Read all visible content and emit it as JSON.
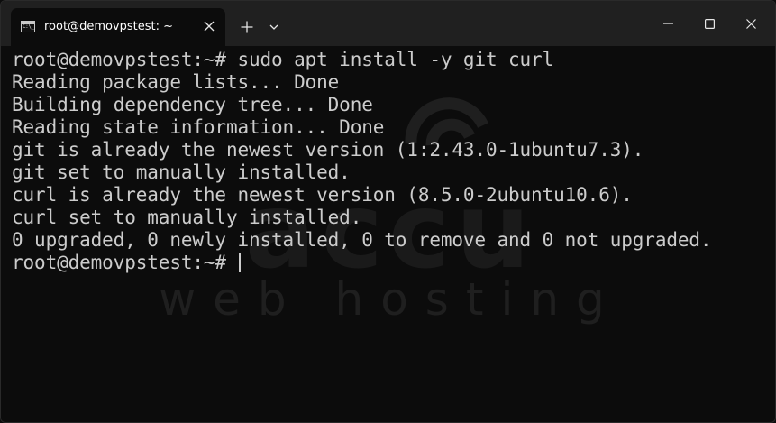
{
  "window": {
    "tab_title": "root@demovpstest: ~",
    "tab_icon": "terminal-icon",
    "icons": {
      "tab_close": "close-icon",
      "new_tab": "plus-icon",
      "dropdown": "chevron-down-icon",
      "minimize": "minimize-icon",
      "maximize": "maximize-icon",
      "close": "close-icon"
    }
  },
  "watermark": {
    "logo_text": "accu",
    "tagline": "web hosting"
  },
  "terminal": {
    "lines": [
      "root@demovpstest:~# sudo apt install -y git curl",
      "Reading package lists... Done",
      "Building dependency tree... Done",
      "Reading state information... Done",
      "git is already the newest version (1:2.43.0-1ubuntu7.3).",
      "git set to manually installed.",
      "curl is already the newest version (8.5.0-2ubuntu10.6).",
      "curl set to manually installed.",
      "0 upgraded, 0 newly installed, 0 to remove and 0 not upgraded."
    ],
    "prompt": "root@demovpstest:~# "
  },
  "colors": {
    "background": "#0c0c0c",
    "titlebar": "#202020",
    "text": "#cccccc"
  }
}
